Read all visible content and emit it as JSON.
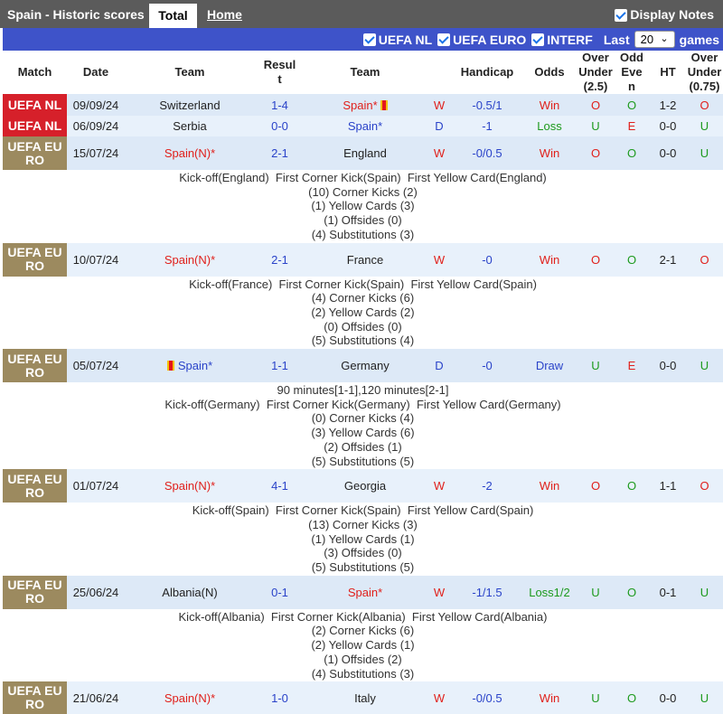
{
  "topbar": {
    "title": "Spain - Historic scores",
    "tab_total": "Total",
    "tab_home": "Home",
    "display_notes": "Display Notes"
  },
  "filters": {
    "items": [
      "UEFA NL",
      "UEFA EURO",
      "INTERF"
    ],
    "last_label": "Last",
    "last_value": "20",
    "games_label": "games"
  },
  "headers": {
    "match": "Match",
    "date": "Date",
    "team1": "Team",
    "result": "Result",
    "team2": "Team",
    "wdl": "",
    "handicap": "Handicap",
    "odds": "Odds",
    "over25": "Over Under (2.5)",
    "oddeven": "Odd Even",
    "ht": "HT",
    "over075": "Over Under (0.75)"
  },
  "colors": {
    "uefa_nl": "#d6202a",
    "uefa_euro": "#9c8a5f",
    "row": "#dde9f7",
    "filter_bar": "#3e53c9"
  },
  "rows": [
    {
      "comp": "UEFA NL",
      "date": "09/09/24",
      "team1": "Switzerland",
      "result": "1-4",
      "team2": "Spain*",
      "wdl": "W",
      "handicap": "-0.5/1",
      "odds": "Win",
      "ou": "O",
      "oe": "O",
      "ht": "1-2",
      "ou075": "O",
      "details": []
    },
    {
      "comp": "UEFA NL",
      "date": "06/09/24",
      "team1": "Serbia",
      "result": "0-0",
      "team2": "Spain*",
      "wdl": "D",
      "handicap": "-1",
      "odds": "Loss",
      "ou": "U",
      "oe": "E",
      "ht": "0-0",
      "ou075": "U",
      "details": []
    },
    {
      "comp": "UEFA EURO",
      "date": "15/07/24",
      "team1": "Spain(N)*",
      "result": "2-1",
      "team2": "England",
      "wdl": "W",
      "handicap": "-0/0.5",
      "odds": "Win",
      "ou": "O",
      "oe": "O",
      "ht": "0-0",
      "ou075": "U",
      "details": [
        "Kick-off(England)  First Corner Kick(Spain)  First Yellow Card(England)",
        "(10) Corner Kicks (2)",
        "(1) Yellow Cards (3)",
        "(1) Offsides (0)",
        "(4) Substitutions (3)"
      ]
    },
    {
      "comp": "UEFA EURO",
      "date": "10/07/24",
      "team1": "Spain(N)*",
      "result": "2-1",
      "team2": "France",
      "wdl": "W",
      "handicap": "-0",
      "odds": "Win",
      "ou": "O",
      "oe": "O",
      "ht": "2-1",
      "ou075": "O",
      "details": [
        "Kick-off(France)  First Corner Kick(Spain)  First Yellow Card(Spain)",
        "(4) Corner Kicks (6)",
        "(2) Yellow Cards (2)",
        "(0) Offsides (0)",
        "(5) Substitutions (4)"
      ]
    },
    {
      "comp": "UEFA EURO",
      "date": "05/07/24",
      "team1": "Spain*",
      "result": "1-1",
      "team2": "Germany",
      "wdl": "D",
      "handicap": "-0",
      "odds": "Draw",
      "ou": "U",
      "oe": "E",
      "ht": "0-0",
      "ou075": "U",
      "details": [
        "90 minutes[1-1],120 minutes[2-1]",
        "Kick-off(Germany)  First Corner Kick(Germany)  First Yellow Card(Germany)",
        "(0) Corner Kicks (4)",
        "(3) Yellow Cards (6)",
        "(2) Offsides (1)",
        "(5) Substitutions (5)"
      ]
    },
    {
      "comp": "UEFA EURO",
      "date": "01/07/24",
      "team1": "Spain(N)*",
      "result": "4-1",
      "team2": "Georgia",
      "wdl": "W",
      "handicap": "-2",
      "odds": "Win",
      "ou": "O",
      "oe": "O",
      "ht": "1-1",
      "ou075": "O",
      "details": [
        "Kick-off(Spain)  First Corner Kick(Spain)  First Yellow Card(Spain)",
        "(13) Corner Kicks (3)",
        "(1) Yellow Cards (1)",
        "(3) Offsides (0)",
        "(5) Substitutions (5)"
      ]
    },
    {
      "comp": "UEFA EURO",
      "date": "25/06/24",
      "team1": "Albania(N)",
      "result": "0-1",
      "team2": "Spain*",
      "wdl": "W",
      "handicap": "-1/1.5",
      "odds": "Loss1/2",
      "ou": "U",
      "oe": "O",
      "ht": "0-1",
      "ou075": "U",
      "details": [
        "Kick-off(Albania)  First Corner Kick(Albania)  First Yellow Card(Albania)",
        "(2) Corner Kicks (6)",
        "(2) Yellow Cards (1)",
        "(1) Offsides (2)",
        "(4) Substitutions (3)"
      ]
    },
    {
      "comp": "UEFA EURO",
      "date": "21/06/24",
      "team1": "Spain(N)*",
      "result": "1-0",
      "team2": "Italy",
      "wdl": "W",
      "handicap": "-0/0.5",
      "odds": "Win",
      "ou": "U",
      "oe": "O",
      "ht": "0-0",
      "ou075": "U",
      "details": []
    }
  ]
}
